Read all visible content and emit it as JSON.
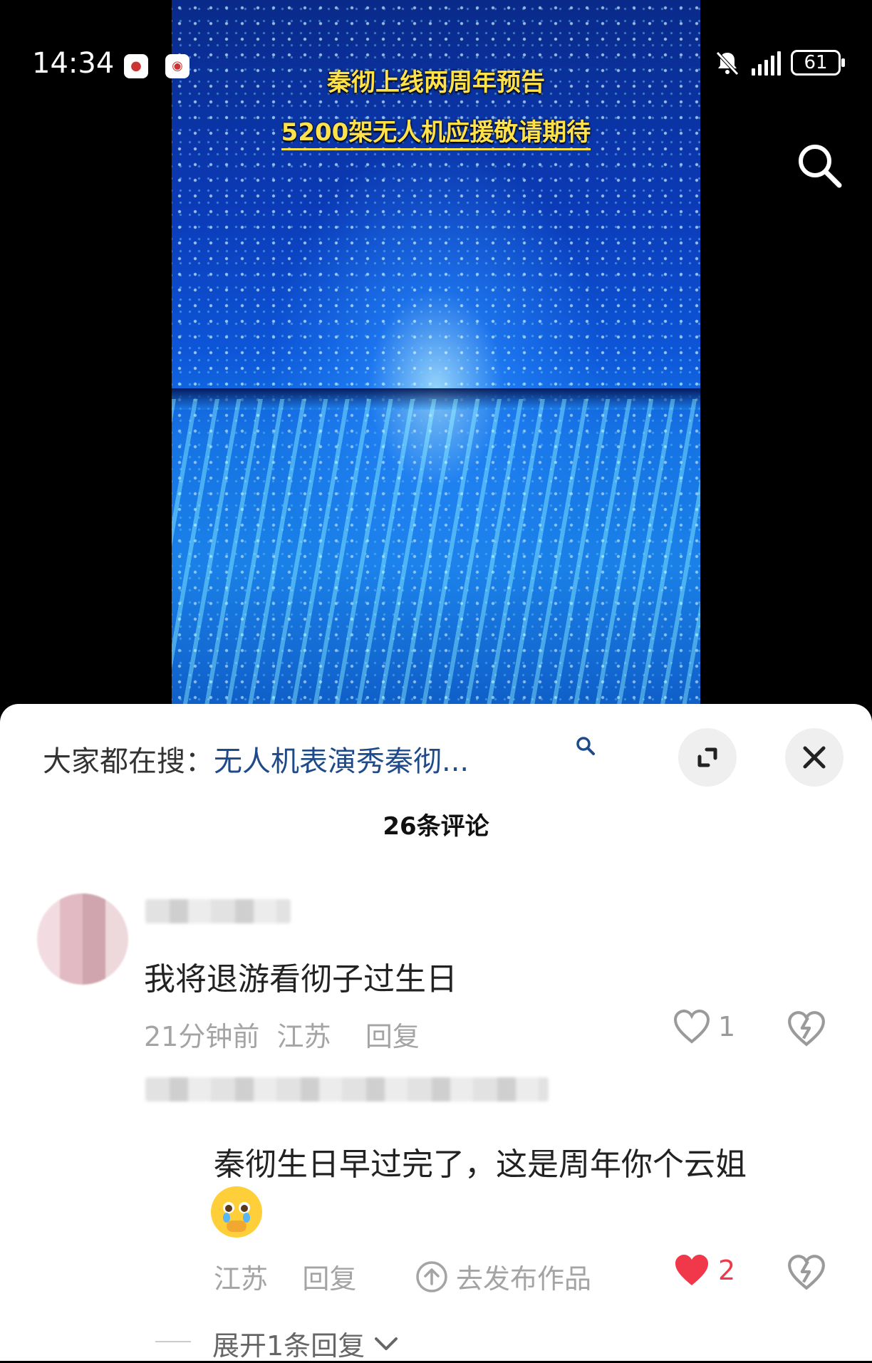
{
  "status_bar": {
    "time": "14:34",
    "battery": "61"
  },
  "video": {
    "caption_line1": "秦彻上线两周年预告",
    "caption_line2": "5200架无人机应援敬请期待"
  },
  "sheet": {
    "hot_search_label": "大家都在搜：",
    "hot_search_keyword": "无人机表演秀秦彻...",
    "comment_count": "26条评论"
  },
  "comments": [
    {
      "text": "我将退游看彻子过生日",
      "time": "21分钟前",
      "location": "江苏",
      "reply_label": "回复",
      "likes": "1"
    }
  ],
  "reply": {
    "text": "秦彻生日早过完了，这是周年你个云姐",
    "location": "江苏",
    "reply_label": "回复",
    "publish_label": "去发布作品",
    "likes": "2",
    "expand_label": "展开1条回复"
  },
  "colors": {
    "like_active": "#f0384a",
    "keyword": "#1f4a8a",
    "caption": "#ffe14a"
  }
}
